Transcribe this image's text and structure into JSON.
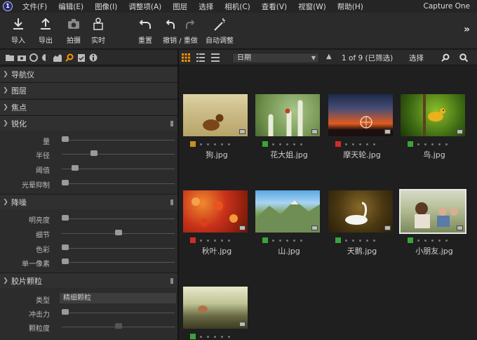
{
  "menubar": {
    "items": [
      "文件(F)",
      "编辑(E)",
      "图像(I)",
      "调整项(A)",
      "图层",
      "选择",
      "相机(C)",
      "查看(V)",
      "视窗(W)",
      "帮助(H)"
    ],
    "title": "Capture One",
    "logo": "1"
  },
  "toolbar": {
    "import": "导入",
    "export": "导出",
    "capture": "拍摄",
    "live": "实时",
    "reset": "重置",
    "undo_redo": "撤销 / 重做",
    "auto_adjust": "自动调整",
    "more": "»"
  },
  "left_panel": {
    "sections": {
      "navigator": "导航仪",
      "layers": "图层",
      "focus": "焦点",
      "sharpen": "锐化",
      "noise": "降噪",
      "grain": "胶片颗粒"
    },
    "sharpen": [
      {
        "label": "量",
        "value": 0.0
      },
      {
        "label": "半径",
        "value": 0.27
      },
      {
        "label": "阈值",
        "value": 0.09
      },
      {
        "label": "光晕抑制",
        "value": 0.0
      }
    ],
    "noise": [
      {
        "label": "明亮度",
        "value": 0.0
      },
      {
        "label": "细节",
        "value": 0.5
      },
      {
        "label": "色彩",
        "value": 0.0
      },
      {
        "label": "单一像素",
        "value": 0.0
      }
    ],
    "grain": {
      "type_label": "类型",
      "type_value": "精细颗粒",
      "impact_label": "冲击力",
      "impact_value": 0.0,
      "granularity_label": "颗粒度",
      "granularity_value": 0.5
    }
  },
  "browser": {
    "sort_by": "日期",
    "counter": "1 of 9  (已筛选)",
    "select": "选择"
  },
  "images": [
    {
      "name": "狗.jpg",
      "color": "#c8901e"
    },
    {
      "name": "花大姐.jpg",
      "color": "#3aa43a"
    },
    {
      "name": "摩天轮.jpg",
      "color": "#d42a2a"
    },
    {
      "name": "鸟.jpg",
      "color": "#3aa43a"
    },
    {
      "name": "秋叶.jpg",
      "color": "#d42a2a"
    },
    {
      "name": "山.jpg",
      "color": "#3aa43a"
    },
    {
      "name": "天鹅.jpg",
      "color": "#3aa43a"
    },
    {
      "name": "小朋友.jpg",
      "color": "#3aa43a"
    },
    {
      "name": "",
      "color": "#3aa43a"
    }
  ],
  "colors": {
    "accent": "#ff9400"
  }
}
